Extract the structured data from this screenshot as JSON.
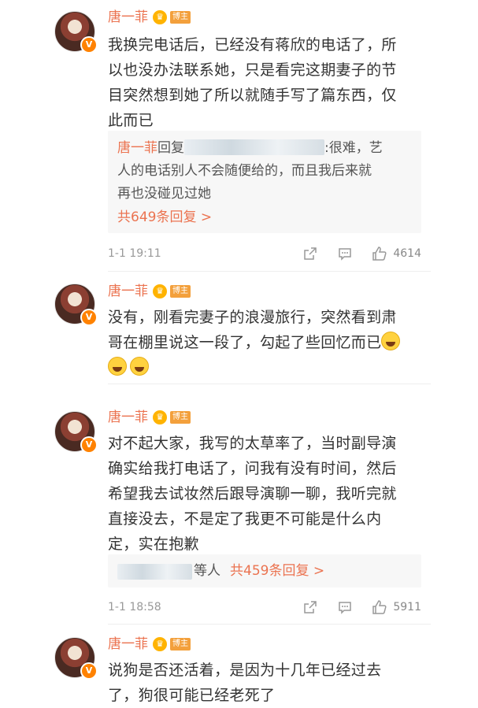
{
  "comments": [
    {
      "name": "唐一菲",
      "tag": "博主",
      "lines": [
        "我换完电话后，已经没有蒋欣的电话了，所",
        "以也没办法联系她，只是看完这期妻子的节",
        "目突然想到她了所以就随手写了篇东西，仅",
        "此而已"
      ],
      "reply": {
        "name": "唐一菲",
        "verb": "回复",
        "lines_first_tail": ":很难，艺",
        "lines": [
          "人的电话别人不会随便给的，而且我后来就",
          "再也没碰见过她"
        ],
        "more": "共649条回复 >"
      },
      "time": "1-1 19:11",
      "likes": "4614"
    },
    {
      "name": "唐一菲",
      "tag": "博主",
      "lines": [
        "没有，刚看完妻子的浪漫旅行，突然看到肃",
        "哥在棚里说这一段了，勾起了些回忆而已"
      ],
      "emoji": "laugh-cry-emoji"
    },
    {
      "name": "唐一菲",
      "tag": "博主",
      "lines": [
        "对不起大家，我写的太草率了，当时副导演",
        "确实给我打电话了，问我有没有时间，然后",
        "希望我去试妆然后跟导演聊一聊，我听完就",
        "直接没去，不是定了我更不可能是什么内",
        "定，实在抱歉"
      ],
      "reply": {
        "others": "等人",
        "more": "共459条回复 >"
      },
      "time": "1-1 18:58",
      "likes": "5911"
    },
    {
      "name": "唐一菲",
      "tag": "博主",
      "lines": [
        "说狗是否还活着，是因为十几年已经过去",
        "了，狗很可能已经老死了"
      ]
    }
  ],
  "icons": {
    "verified": "verified-v-icon",
    "crown": "crown-icon",
    "share": "share-icon",
    "comment": "comment-icon",
    "like": "like-icon"
  },
  "colors": {
    "name": "#eb7350",
    "badge": "#f3a03c",
    "verified": "#ff8200",
    "text": "#333333",
    "meta": "#999999"
  }
}
